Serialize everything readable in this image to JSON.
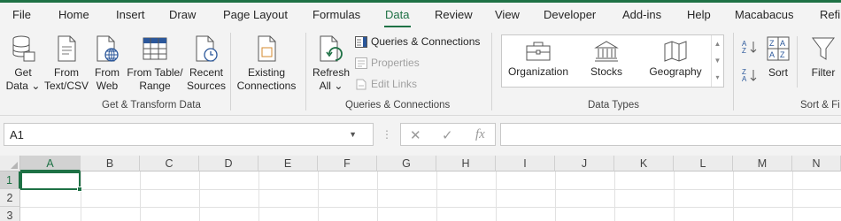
{
  "menu": {
    "tabs": [
      "File",
      "Home",
      "Insert",
      "Draw",
      "Page Layout",
      "Formulas",
      "Data",
      "Review",
      "View",
      "Developer",
      "Add-ins",
      "Help",
      "Macabacus",
      "Refi"
    ],
    "active": "Data"
  },
  "ribbon": {
    "get_transform": {
      "get_data": {
        "line1": "Get",
        "line2": "Data",
        "arrow": "⌄"
      },
      "from_text_csv": {
        "line1": "From",
        "line2": "Text/CSV"
      },
      "from_web": {
        "line1": "From",
        "line2": "Web"
      },
      "from_table_range": {
        "line1": "From Table/",
        "line2": "Range"
      },
      "recent_sources": {
        "line1": "Recent",
        "line2": "Sources"
      },
      "existing_connections": {
        "line1": "Existing",
        "line2": "Connections"
      },
      "label": "Get & Transform Data"
    },
    "queries": {
      "refresh_all": {
        "line1": "Refresh",
        "line2": "All",
        "arrow": "⌄"
      },
      "queries_connections": "Queries & Connections",
      "properties": "Properties",
      "edit_links": "Edit Links",
      "label": "Queries & Connections"
    },
    "data_types": {
      "items": [
        "Organization",
        "Stocks",
        "Geography"
      ],
      "label": "Data Types"
    },
    "sort_filter": {
      "sort": "Sort",
      "filter": "Filter",
      "label": "Sort & Fi"
    }
  },
  "formula_bar": {
    "name_box": "A1",
    "fx": "fx",
    "formula": ""
  },
  "grid": {
    "columns": [
      "A",
      "B",
      "C",
      "D",
      "E",
      "F",
      "G",
      "H",
      "I",
      "J",
      "K",
      "L",
      "M",
      "N"
    ],
    "rows": [
      "1",
      "2",
      "3"
    ],
    "selected_cell": "A1"
  },
  "colors": {
    "accent": "#1e7145",
    "ribbon_bg": "#f3f3f3",
    "icon_blue": "#2b579a"
  }
}
